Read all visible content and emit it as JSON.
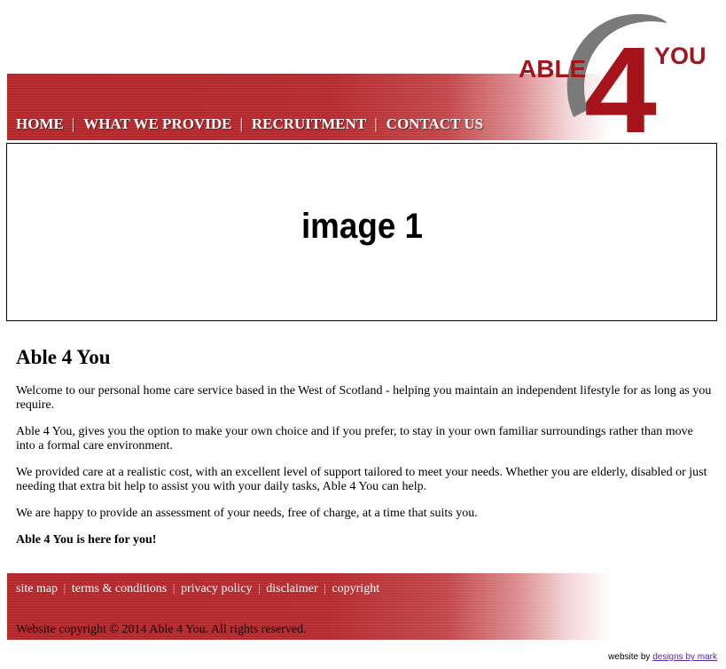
{
  "brand": {
    "logo_word1": "ABLE",
    "logo_number": "4",
    "logo_word2": "YOU",
    "color_primary": "#b3262a",
    "color_logo_red": "#a5141a",
    "color_logo_gray": "#7a7a7a"
  },
  "nav": {
    "items": [
      {
        "label": "HOME"
      },
      {
        "label": "WHAT WE PROVIDE"
      },
      {
        "label": "RECRUITMENT"
      },
      {
        "label": "CONTACT US"
      }
    ],
    "separator": "|"
  },
  "hero": {
    "label": "image 1"
  },
  "main": {
    "title": "Able 4 You",
    "paragraphs": [
      "Welcome to our personal home care service based in the West of Scotland - helping you maintain an independent lifestyle for as long as you require.",
      "Able 4 You, gives you the option to make your own choice and if you prefer, to stay in your own familiar surroundings rather than move into a formal care environment.",
      "We provided care at a realistic cost, with an excellent level of support tailored to meet your needs. Whether you are elderly, disabled or just needing that extra bit help to assist you with your daily tasks, Able 4 You can help.",
      "We are happy to provide an assessment of your needs, free of charge, at a time that suits you."
    ],
    "tagline": "Able 4 You is here for you!"
  },
  "footer": {
    "links": [
      {
        "label": "site map"
      },
      {
        "label": "terms & conditions"
      },
      {
        "label": "privacy policy"
      },
      {
        "label": "disclaimer"
      },
      {
        "label": "copyright"
      }
    ],
    "separator": "|",
    "copyright": "Website copyright © 2014 Able 4 You. All rights reserved."
  },
  "credit": {
    "prefix": "website by",
    "link_label": "designs by mark"
  }
}
